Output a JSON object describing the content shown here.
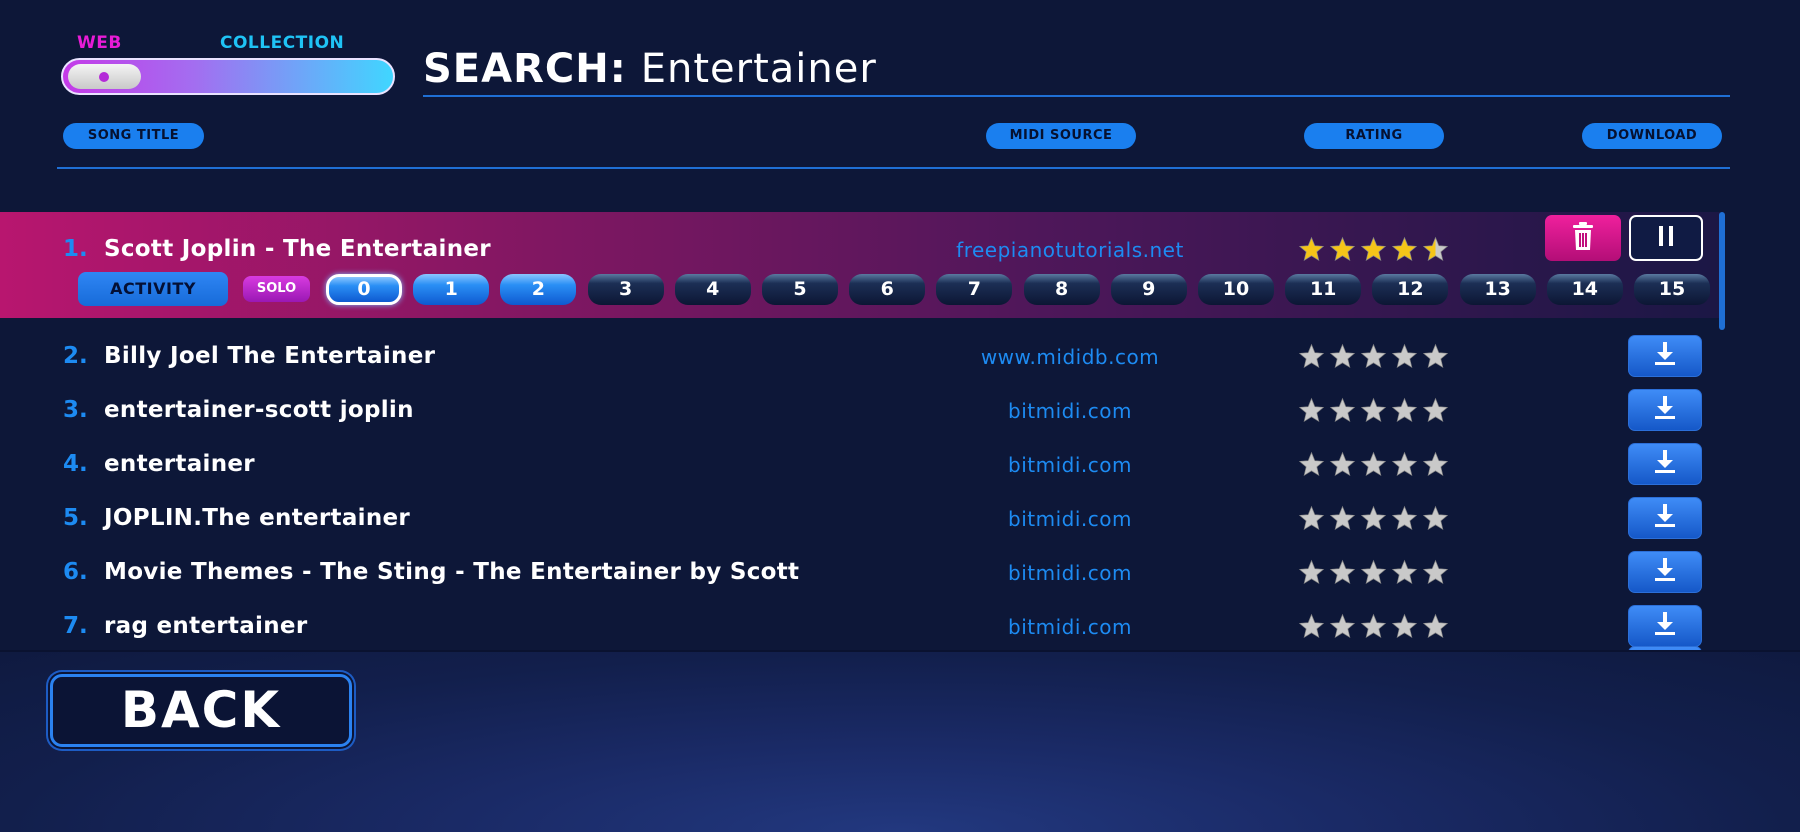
{
  "toggle": {
    "left_label": "WEB",
    "right_label": "COLLECTION",
    "selected": "WEB"
  },
  "search": {
    "key": "SEARCH:",
    "query": "Entertainer"
  },
  "columns": {
    "title": "SONG TITLE",
    "source": "MIDI SOURCE",
    "rating": "RATING",
    "download": "DOWNLOAD"
  },
  "results": [
    {
      "num": "1.",
      "title": "Scott Joplin - The Entertainer",
      "source": "freepianotutorials.net",
      "rating": 4.5,
      "active": true
    },
    {
      "num": "2.",
      "title": "Billy Joel The Entertainer",
      "source": "www.mididb.com",
      "rating": 0
    },
    {
      "num": "3.",
      "title": "entertainer-scott joplin",
      "source": "bitmidi.com",
      "rating": 0
    },
    {
      "num": "4.",
      "title": "entertainer",
      "source": "bitmidi.com",
      "rating": 0
    },
    {
      "num": "5.",
      "title": "JOPLIN.The entertainer",
      "source": "bitmidi.com",
      "rating": 0
    },
    {
      "num": "6.",
      "title": "Movie Themes - The Sting - The Entertainer by Scott",
      "source": "bitmidi.com",
      "rating": 0
    },
    {
      "num": "7.",
      "title": "rag entertainer",
      "source": "bitmidi.com",
      "rating": 0
    }
  ],
  "active_controls": {
    "activity_label": "ACTIVITY",
    "solo_label": "SOLO",
    "channels": [
      "0",
      "1",
      "2",
      "3",
      "4",
      "5",
      "6",
      "7",
      "8",
      "9",
      "10",
      "11",
      "12",
      "13",
      "14",
      "15"
    ],
    "channels_on": [
      0,
      1,
      2
    ],
    "channel_selected": 0
  },
  "icons": {
    "trash": "trash-icon",
    "pause": "pause-icon",
    "download": "download-icon",
    "star": "star-icon"
  },
  "colors": {
    "accent_blue": "#1d8bf2",
    "accent_pink": "#e81bd6",
    "star_gold": "#f5c518",
    "star_gray": "#c9c9c9"
  },
  "back_label": "BACK"
}
